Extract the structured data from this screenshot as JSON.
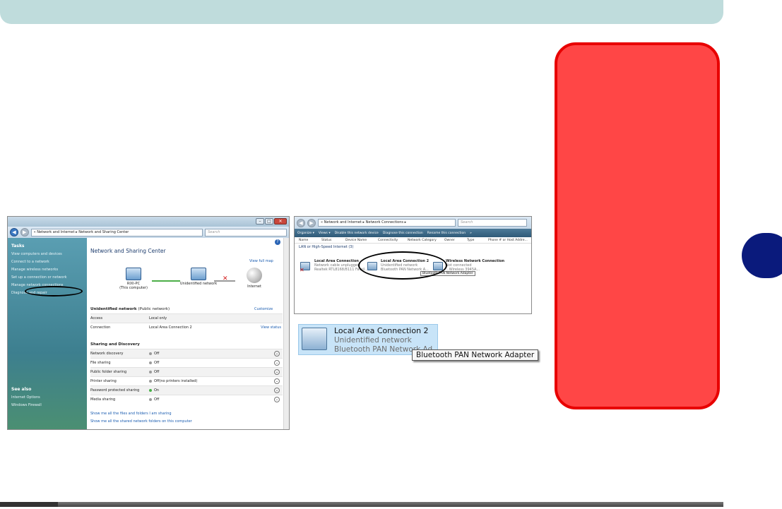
{
  "network_center": {
    "address": "« Network and Internet ▸ Network and Sharing Center",
    "search_placeholder": "Search",
    "tasks_heading": "Tasks",
    "tasks": [
      "View computers and devices",
      "Connect to a network",
      "Manage wireless networks",
      "Set up a connection or network",
      "Manage network connections",
      "Diagnose and repair"
    ],
    "see_also_heading": "See also",
    "see_also": [
      "Internet Options",
      "Windows Firewall"
    ],
    "title": "Network and Sharing Center",
    "view_full_map": "View full map",
    "computer_name": "RIXI-PC",
    "computer_sub": "(This computer)",
    "network_node": "Unidentified network",
    "internet_node": "Internet",
    "network_heading": "Unidentified network",
    "network_type": "(Public network)",
    "customize": "Customize",
    "access_label": "Access",
    "access_value": "Local only",
    "connection_label": "Connection",
    "connection_value": "Local Area Connection 2",
    "view_status": "View status",
    "sharing_heading": "Sharing and Discovery",
    "sharing_rows": [
      {
        "label": "Network discovery",
        "value": "Off"
      },
      {
        "label": "File sharing",
        "value": "Off"
      },
      {
        "label": "Public folder sharing",
        "value": "Off"
      },
      {
        "label": "Printer sharing",
        "value": "Off(no printers installed)"
      },
      {
        "label": "Password protected sharing",
        "value": "On"
      },
      {
        "label": "Media sharing",
        "value": "Off"
      }
    ],
    "footer_links": [
      "Show me all the files and folders I am sharing",
      "Show me all the shared network folders on this computer"
    ]
  },
  "network_connections": {
    "address": "« Network and Internet ▸ Network Connections ▸",
    "search_placeholder": "Search",
    "toolbar": [
      "Organize ▾",
      "Views ▾",
      "Disable this network device",
      "Diagnose this connection",
      "Rename this connection",
      "»"
    ],
    "columns": [
      "Name",
      "Status",
      "Device Name",
      "Connectivity",
      "Network Category",
      "Owner",
      "Type",
      "Phone # or Host Addre..."
    ],
    "group": "LAN or High-Speed Internet (3)",
    "connections": [
      {
        "name": "Local Area Connection",
        "status": "Network cable unplugged",
        "device": "Realtek RTL8168/8111 Famil..."
      },
      {
        "name": "Local Area Connection 2",
        "status": "Unidentified network",
        "device": "Bluetooth PAN Network A..."
      },
      {
        "name": "Wireless Network Connection",
        "status": "Not connected",
        "device": "...Wireless 3945A..."
      }
    ],
    "tooltip": "Bluetooth PAN Network Adapter"
  },
  "zoom": {
    "name": "Local Area Connection 2",
    "status": "Unidentified network",
    "device": "Bluetooth PAN Network Ad",
    "tooltip": "Bluetooth PAN Network Adapter"
  }
}
